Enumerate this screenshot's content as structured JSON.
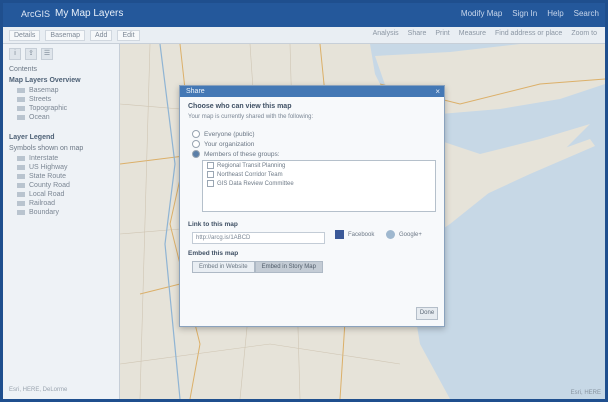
{
  "header": {
    "app_label": "ArcGIS",
    "title": "My Map Layers",
    "links": [
      "Modify Map",
      "Sign In",
      "Help",
      "Search"
    ]
  },
  "toolbar": {
    "left": [
      "Details",
      "Basemap",
      "Add",
      "Edit"
    ],
    "right": [
      "Analysis",
      "Share",
      "Print",
      "Measure",
      "Find address or place",
      "Zoom to"
    ]
  },
  "sidebar": {
    "icons": [
      "about-icon",
      "share-icon",
      "content-icon"
    ],
    "section1_title": "Contents",
    "section1_heading": "Map Layers Overview",
    "section1_items": [
      "Basemap",
      "Streets",
      "Topographic",
      "Ocean"
    ],
    "section2_heading": "Layer Legend",
    "section2_sub": "Symbols shown on map",
    "section2_items": [
      "Interstate",
      "US Highway",
      "State Route",
      "County Road",
      "Local Road",
      "Railroad",
      "Boundary"
    ],
    "footer": "Esri, HERE, DeLorme"
  },
  "dialog": {
    "title": "Share",
    "close": "×",
    "heading": "Choose who can view this map",
    "sub": "Your map is currently shared with the following:",
    "radios": [
      "Everyone (public)",
      "Your organization"
    ],
    "groups_label": "Members of these groups:",
    "groups": [
      "Regional Transit Planning",
      "Northeast Corridor Team",
      "GIS Data Review Committee"
    ],
    "link_heading": "Link to this map",
    "link_url": "http://arcg.is/1ABCD",
    "share_fb": "Facebook",
    "share_gp": "Google+",
    "embed_heading": "Embed this map",
    "embed_tabs": [
      "Embed in Website",
      "Embed in Story Map"
    ],
    "close_label": "Done"
  },
  "map": {
    "attribution": "Esri, HERE"
  },
  "colors": {
    "frame": "#1f4f8e",
    "titlebar": "#24589b",
    "ocean": "#c7d8e6",
    "land": "#e6e3d9"
  }
}
